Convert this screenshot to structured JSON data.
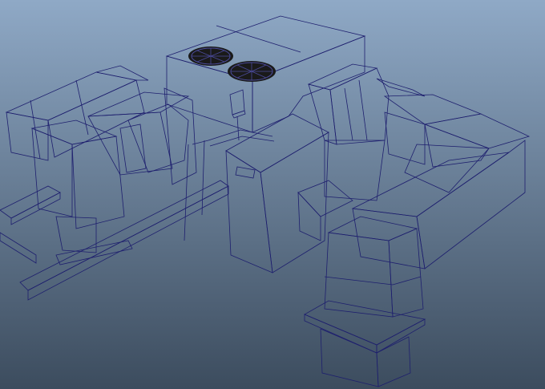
{
  "viewport": {
    "background_top": "#8fa9c6",
    "background_bottom": "#3c4c5e",
    "wireframe_color": "#1e1f6e",
    "surface_light": "#b9b9b9",
    "surface_mid": "#a3a3a3",
    "surface_dark": "#8a8a8a"
  },
  "scene": {
    "objects": [
      "condenser-unit",
      "condenser-fan-left",
      "condenser-fan-right",
      "electrical-disconnect-box",
      "air-handler-unit",
      "left-duct-run",
      "left-blower-housing",
      "left-vertical-duct",
      "right-duct-elbow",
      "right-duct-run",
      "front-vertical-duct",
      "front-duct-flange",
      "steel-support-frame",
      "refrigerant-piping"
    ]
  }
}
